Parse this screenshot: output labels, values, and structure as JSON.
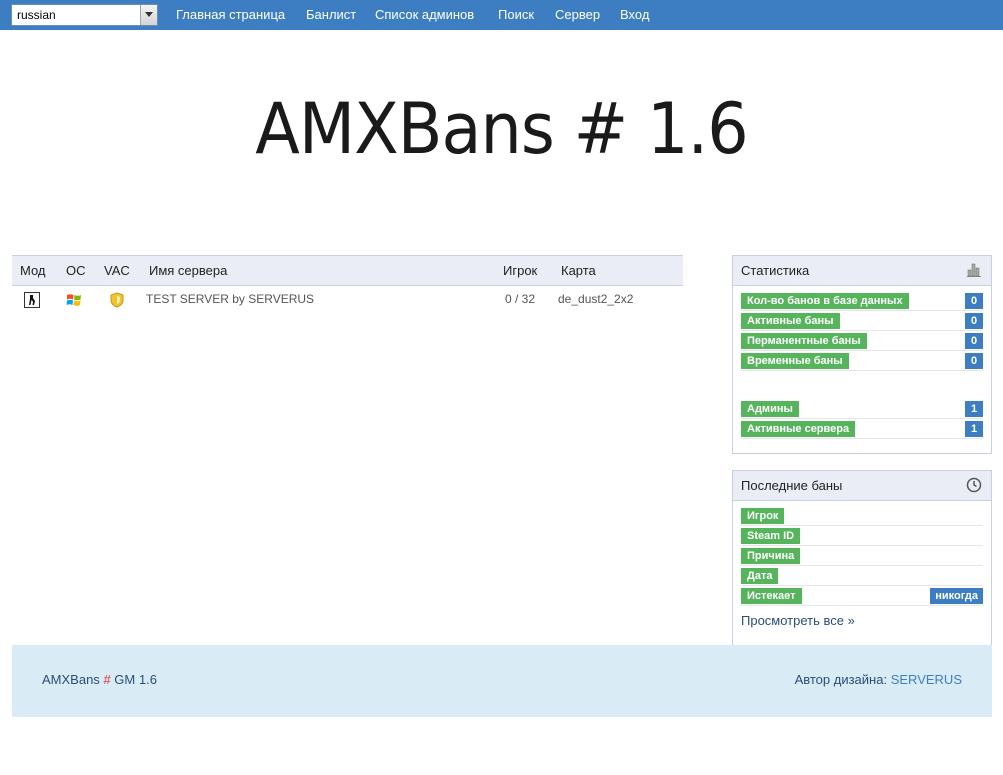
{
  "nav": {
    "language": "russian",
    "links": [
      "Главная страница",
      "Банлист",
      "Список админов",
      "Поиск",
      "Сервер",
      "Вход"
    ]
  },
  "site_title": "AMXBans # 1.6",
  "servers": {
    "columns": [
      "Мод",
      "ОС",
      "VAC",
      "Имя сервера",
      "Игрок",
      "Карта"
    ],
    "rows": [
      {
        "mod": "cstrike-icon",
        "os": "windows-icon",
        "vac": "vac-shield-icon",
        "name": "TEST SERVER by SERVERUS",
        "players": "0 / 32",
        "map": "de_dust2_2x2"
      }
    ]
  },
  "stats": {
    "title": "Статистика",
    "icon": "bar-chart-icon",
    "items": [
      {
        "label": "Кол-во банов в базе данных",
        "value": "0"
      },
      {
        "label": "Активные баны",
        "value": "0"
      },
      {
        "label": "Перманентные баны",
        "value": "0"
      },
      {
        "label": "Временные баны",
        "value": "0"
      }
    ],
    "items2": [
      {
        "label": "Админы",
        "value": "1"
      },
      {
        "label": "Активные сервера",
        "value": "1"
      }
    ]
  },
  "last_bans": {
    "title": "Последние баны",
    "icon": "clock-icon",
    "fields": [
      {
        "label": "Игрок",
        "value": ""
      },
      {
        "label": "Steam ID",
        "value": ""
      },
      {
        "label": "Причина",
        "value": ""
      },
      {
        "label": "Дата",
        "value": ""
      },
      {
        "label": "Истекает",
        "value": "никогда"
      }
    ],
    "view_all": "Просмотреть все »"
  },
  "footer": {
    "brand": "AMXBans",
    "hash": "#",
    "version": "GM 1.6",
    "design_label": "Автор дизайна:",
    "design_author": "SERVERUS"
  },
  "colors": {
    "nav_bg": "#3d7ec3",
    "label_green": "#56b45c",
    "value_blue": "#3d7ec3",
    "footer_bg": "#d9ebf5"
  }
}
